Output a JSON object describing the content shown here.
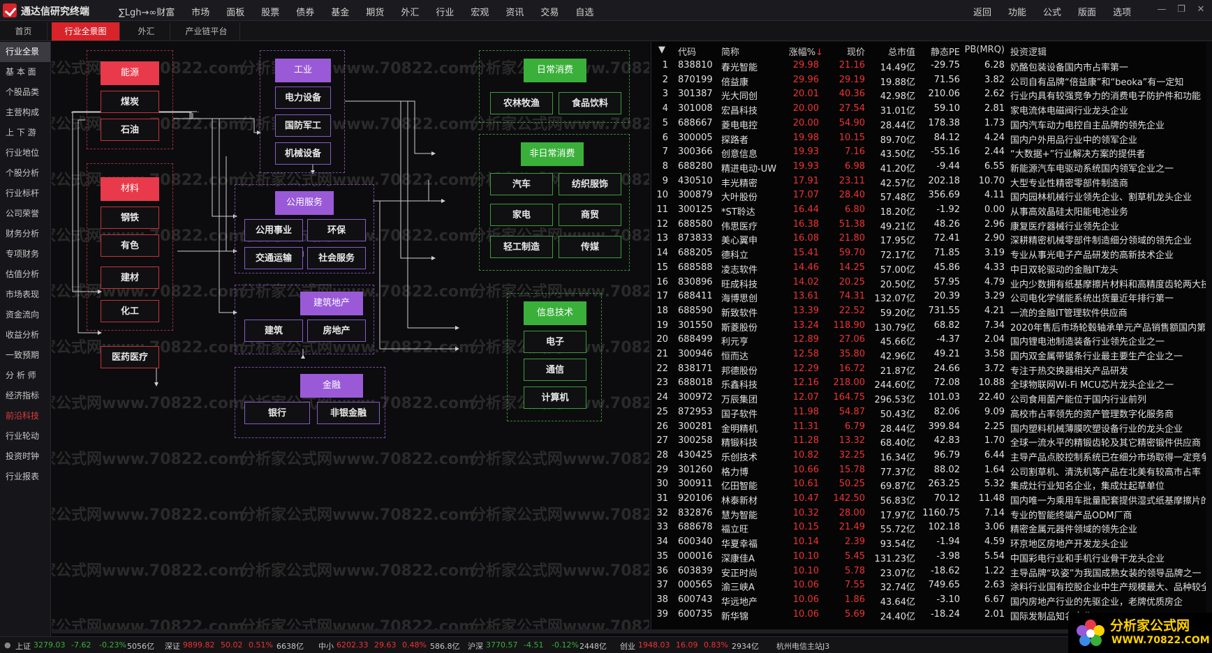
{
  "app": {
    "title": "通达信研究终端"
  },
  "menu": [
    "∑Lgh→∞财富",
    "市场",
    "面板",
    "股票",
    "债券",
    "基金",
    "期货",
    "外汇",
    "行业",
    "宏观",
    "资讯",
    "交易",
    "自选"
  ],
  "right_menu": [
    "返回",
    "功能",
    "公式",
    "版面",
    "选项"
  ],
  "tabs": [
    "首页",
    "行业全景图",
    "外汇",
    "产业链平台"
  ],
  "sidebar": [
    "行业全景",
    "基 本 面",
    "个股品类",
    "主营构成",
    "上 下 游",
    "行业地位",
    "个股分析",
    "行业标杆",
    "公司荣誉",
    "财务分析",
    "专项财务",
    "估值分析",
    "市场表现",
    "资金流向",
    "收益分析",
    "一致预期",
    "分 析 师",
    "经济指标",
    "前沿科技",
    "行业轮动",
    "投资时钟",
    "行业报表"
  ],
  "watermark": "分析家公式网www.70822.com",
  "diagram": {
    "energy": {
      "head": "能源",
      "items": [
        "煤炭",
        "石油"
      ]
    },
    "materials": {
      "head": "材料",
      "items": [
        "钢铁",
        "有色",
        "建材",
        "化工"
      ]
    },
    "pharma": "医药医疗",
    "industry": {
      "head": "工业",
      "items": [
        "电力设备",
        "国防军工",
        "机械设备"
      ]
    },
    "public": {
      "head": "公用服务",
      "items": [
        "公用事业",
        "环保",
        "交通运输",
        "社会服务"
      ]
    },
    "construction": {
      "head": "建筑地产",
      "items": [
        "建筑",
        "房地产"
      ]
    },
    "finance": {
      "head": "金融",
      "items": [
        "银行",
        "非银金融"
      ]
    },
    "daily": {
      "head": "日常消费",
      "items": [
        "农林牧渔",
        "食品饮料"
      ]
    },
    "nondaily": {
      "head": "非日常消费",
      "items": [
        "汽车",
        "纺织服饰",
        "家电",
        "商贸",
        "轻工制造",
        "传媒"
      ]
    },
    "it": {
      "head": "信息技术",
      "items": [
        "电子",
        "通信",
        "计算机"
      ]
    }
  },
  "table": {
    "headers": [
      "代码",
      "简称",
      "涨幅%",
      "现价",
      "总市值",
      "静态PE",
      "PB(MRQ)",
      "投资逻辑"
    ],
    "rows": [
      [
        "1",
        "838810",
        "春光智能",
        "29.98",
        "21.16",
        "14.49亿",
        "-29.75",
        "6.28",
        "奶酪包装设备国内市占率第一"
      ],
      [
        "2",
        "870199",
        "倍益康",
        "29.96",
        "29.19",
        "19.88亿",
        "71.56",
        "3.82",
        "公司自有品牌“倍益康”和“beoka”有一定知"
      ],
      [
        "3",
        "301387",
        "光大同创",
        "20.01",
        "40.36",
        "42.98亿",
        "210.06",
        "2.62",
        "行业内具有较强竞争力的消费电子防护件和功能"
      ],
      [
        "4",
        "301008",
        "宏昌科技",
        "20.00",
        "27.54",
        "31.01亿",
        "59.10",
        "2.81",
        "家电流体电磁阀行业龙头企业"
      ],
      [
        "5",
        "688667",
        "菱电电控",
        "20.00",
        "54.90",
        "28.44亿",
        "178.38",
        "1.73",
        "国内汽车动力电控自主品牌的领先企业"
      ],
      [
        "6",
        "300005",
        "探路者",
        "19.98",
        "10.15",
        "89.70亿",
        "84.12",
        "4.24",
        "国内户外用品行业中的领军企业"
      ],
      [
        "7",
        "300366",
        "创意信息",
        "19.93",
        "7.16",
        "43.50亿",
        "-55.16",
        "2.44",
        "“大数据+”行业解决方案的提供者"
      ],
      [
        "8",
        "688280",
        "精进电动-UW",
        "19.93",
        "6.98",
        "41.20亿",
        "-9.44",
        "6.55",
        "新能源汽车电驱动系统国内领军企业之一"
      ],
      [
        "9",
        "430510",
        "丰光精密",
        "17.91",
        "23.11",
        "42.57亿",
        "202.18",
        "10.70",
        "大型专业性精密零部件制造商"
      ],
      [
        "10",
        "300879",
        "大叶股份",
        "17.07",
        "28.40",
        "57.48亿",
        "356.69",
        "4.11",
        "国内园林机械行业领先企业、割草机龙头企业"
      ],
      [
        "11",
        "300125",
        "*ST聆达",
        "16.44",
        "6.80",
        "18.20亿",
        "-1.92",
        "0.00",
        "从事高效晶硅太阳能电池业务"
      ],
      [
        "12",
        "688580",
        "伟思医疗",
        "16.38",
        "51.38",
        "49.21亿",
        "48.26",
        "2.96",
        "康复医疗器械行业领先企业"
      ],
      [
        "13",
        "873833",
        "美心翼申",
        "16.08",
        "21.80",
        "17.95亿",
        "72.41",
        "2.90",
        "深耕精密机械零部件制造细分领域的领先企业"
      ],
      [
        "14",
        "688205",
        "德科立",
        "15.41",
        "59.70",
        "72.17亿",
        "71.85",
        "3.19",
        "专业从事光电子产品研发的高新技术企业"
      ],
      [
        "15",
        "688588",
        "凌志软件",
        "14.46",
        "14.25",
        "57.00亿",
        "45.86",
        "4.33",
        "中日双轮驱动的金融IT龙头"
      ],
      [
        "16",
        "830896",
        "旺成科技",
        "14.02",
        "20.25",
        "20.50亿",
        "57.95",
        "4.79",
        "业内少数拥有纸基摩擦片材料和高精度齿轮两大技"
      ],
      [
        "17",
        "688411",
        "海博思创",
        "13.61",
        "74.31",
        "132.07亿",
        "20.39",
        "3.29",
        "公司电化学储能系统出货量近年排行第一"
      ],
      [
        "18",
        "688590",
        "新致软件",
        "13.39",
        "22.52",
        "59.20亿",
        "731.55",
        "4.21",
        "一流的金融IT管理软件供应商"
      ],
      [
        "19",
        "301550",
        "斯菱股份",
        "13.24",
        "118.90",
        "130.79亿",
        "68.82",
        "7.34",
        "2020年售后市场轮毂轴承单元产品销售额国内第"
      ],
      [
        "20",
        "688499",
        "利元亨",
        "12.89",
        "27.06",
        "45.66亿",
        "-4.37",
        "2.04",
        "国内锂电池制造装备行业领先企业之一"
      ],
      [
        "21",
        "300946",
        "恒而达",
        "12.58",
        "35.80",
        "42.96亿",
        "49.21",
        "3.58",
        "国内双金属带锯条行业最主要生产企业之一"
      ],
      [
        "22",
        "838171",
        "邦德股份",
        "12.29",
        "16.72",
        "21.87亿",
        "24.66",
        "3.72",
        "专注于热交换器相关产品研发"
      ],
      [
        "23",
        "688018",
        "乐鑫科技",
        "12.16",
        "218.00",
        "244.60亿",
        "72.08",
        "10.88",
        "全球物联网Wi-Fi MCU芯片龙头企业之一"
      ],
      [
        "24",
        "300972",
        "万辰集团",
        "12.07",
        "164.75",
        "296.53亿",
        "101.03",
        "22.40",
        "公司食用菌产能位于国内行业前列"
      ],
      [
        "25",
        "872953",
        "国子软件",
        "11.98",
        "54.87",
        "50.43亿",
        "82.06",
        "9.09",
        "高校市占率领先的资产管理数字化服务商"
      ],
      [
        "26",
        "300281",
        "金明精机",
        "11.31",
        "6.79",
        "28.44亿",
        "399.84",
        "2.25",
        "国内塑料机械薄膜吹塑设备行业的龙头企业"
      ],
      [
        "27",
        "300258",
        "精锻科技",
        "11.28",
        "13.32",
        "68.40亿",
        "42.83",
        "1.70",
        "全球一流水平的精锻齿轮及其它精密锻件供应商"
      ],
      [
        "28",
        "430425",
        "乐创技术",
        "10.82",
        "32.25",
        "16.34亿",
        "96.79",
        "6.44",
        "主导产品点胶控制系统已在细分市场取得一定竞争"
      ],
      [
        "29",
        "301260",
        "格力博",
        "10.66",
        "15.78",
        "77.37亿",
        "88.02",
        "1.64",
        "公司割草机、清洗机等产品在北美有较高市占率"
      ],
      [
        "30",
        "300911",
        "亿田智能",
        "10.61",
        "50.25",
        "69.87亿",
        "263.25",
        "5.32",
        "集成灶行业知名企业，集成灶起草单位"
      ],
      [
        "31",
        "920106",
        "林泰新材",
        "10.47",
        "142.50",
        "56.83亿",
        "70.12",
        "11.48",
        "国内唯一为乘用车批量配套提供湿式纸基摩擦片的"
      ],
      [
        "32",
        "832876",
        "慧为智能",
        "10.32",
        "28.00",
        "17.97亿",
        "1160.75",
        "7.14",
        "专业的智能终端产品ODM厂商"
      ],
      [
        "33",
        "688678",
        "福立旺",
        "10.15",
        "21.49",
        "55.72亿",
        "102.18",
        "3.06",
        "精密金属元器件领域的领先企业"
      ],
      [
        "34",
        "600340",
        "华夏幸福",
        "10.14",
        "2.39",
        "93.54亿",
        "-1.94",
        "4.59",
        "环京地区房地产开发龙头企业"
      ],
      [
        "35",
        "000016",
        "深康佳A",
        "10.10",
        "5.45",
        "131.23亿",
        "-3.98",
        "5.54",
        "中国彩电行业和手机行业骨干龙头企业"
      ],
      [
        "36",
        "603839",
        "安正时尚",
        "10.10",
        "5.78",
        "23.07亿",
        "-18.62",
        "1.22",
        "主导品牌“玖姿”为我国成熟女装的领导品牌之一"
      ],
      [
        "37",
        "000565",
        "渝三峡A",
        "10.06",
        "7.55",
        "32.74亿",
        "749.65",
        "2.63",
        "涂料行业国有控股企业中生产规模最大、品种较全"
      ],
      [
        "38",
        "600743",
        "华远地产",
        "10.06",
        "1.86",
        "43.64亿",
        "-3.10",
        "6.67",
        "国内房地产行业的先驱企业，老牌优质房企"
      ],
      [
        "39",
        "600735",
        "新华锦",
        "10.06",
        "5.69",
        "24.40亿",
        "-18.24",
        "2.01",
        "国际发制品知名企业"
      ]
    ]
  },
  "status": [
    {
      "name": "上证",
      "val": "3279.03",
      "chg": "-7.62",
      "pct": "-0.23%",
      "amt": "5056亿"
    },
    {
      "name": "深证",
      "val": "9899.82",
      "chg": "50.02",
      "pct": "0.51%",
      "amt": "6638亿"
    },
    {
      "name": "中小",
      "val": "6202.33",
      "chg": "29.63",
      "pct": "0.48%",
      "amt": "586.8亿"
    },
    {
      "name": "沪深",
      "val": "3770.57",
      "chg": "-4.51",
      "pct": "-0.12%",
      "amt": "2448亿"
    },
    {
      "name": "创业",
      "val": "1948.03",
      "chg": "16.09",
      "pct": "0.83%",
      "amt": "2934亿"
    }
  ],
  "server": "杭州电信主站J3",
  "brand": {
    "main": "分析家公式网",
    "url": "WWW.70822.COM"
  }
}
